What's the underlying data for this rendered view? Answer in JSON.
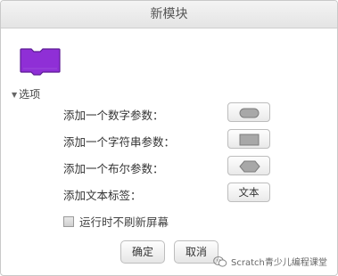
{
  "dialog": {
    "title": "新模块"
  },
  "block_preview": {
    "color": "#8f2fd6",
    "border_color": "#5c1a94"
  },
  "options": {
    "toggle_label": "选项",
    "rows": [
      {
        "label": "添加一个数字参数：",
        "button_icon": "number-slot-icon"
      },
      {
        "label": "添加一个字符串参数：",
        "button_icon": "string-slot-icon"
      },
      {
        "label": "添加一个布尔参数：",
        "button_icon": "boolean-slot-icon"
      },
      {
        "label": "添加文本标签：",
        "button_text": "文本"
      }
    ],
    "run_without_refresh": {
      "label": "运行时不刷新屏幕",
      "checked": false
    }
  },
  "footer": {
    "ok_label": "确定",
    "cancel_label": "取消"
  },
  "watermark": {
    "text": "Scratch青少儿编程课堂"
  }
}
